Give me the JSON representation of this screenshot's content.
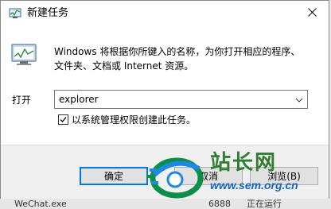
{
  "window": {
    "title": "新建任务",
    "close_icon": "close-icon"
  },
  "dialog": {
    "description": "Windows 将根据你所键入的名称，为你打开相应的程序、文件夹、文档或 Internet 资源。",
    "open_label": "打开",
    "command_value": "explorer",
    "admin_checked": true,
    "admin_label": "以系统管理权限创建此任务。"
  },
  "buttons": {
    "ok": "确定",
    "cancel": "取消",
    "browse": "浏览(B)"
  },
  "background_row": {
    "name": "WeChat.exe",
    "value": "6888",
    "state": "正在运行"
  },
  "watermark": {
    "cn_text": "站长网",
    "url": "www.sem.org.cn"
  },
  "colors": {
    "accent": "#0078d7",
    "footer_bg": "#f0f0f0",
    "watermark_green": "#2e7d32",
    "watermark_blue": "#1565c0"
  }
}
